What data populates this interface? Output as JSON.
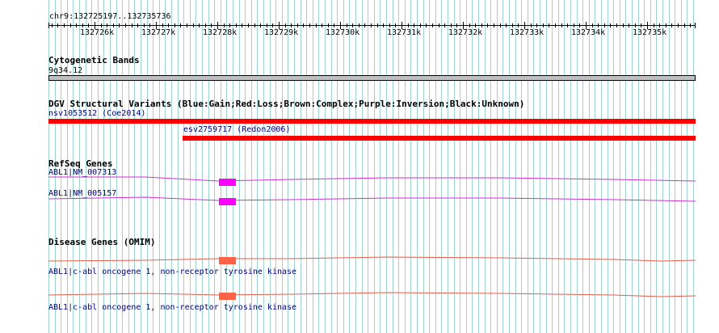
{
  "ruler": {
    "position": "chr9:132725197..132735736",
    "ticks": [
      "132726k",
      "132727k",
      "132728k",
      "132729k",
      "132730k",
      "132731k",
      "132732k",
      "132733k",
      "132734k",
      "132735k"
    ]
  },
  "tracks": {
    "cytoband": {
      "title": "Cytogenetic Bands",
      "band_label": "9q34.12"
    },
    "dgv": {
      "title": "DGV Structural Variants (Blue:Gain;Red:Loss;Brown:Complex;Purple:Inversion;Black:Unknown)",
      "features": [
        {
          "label": "nsv1053512 (Coe2014)",
          "color": "#ff0000"
        },
        {
          "label": "esv2759717 (Redon2006)",
          "color": "#ff0000"
        }
      ]
    },
    "refseq": {
      "title": "RefSeq Genes",
      "features": [
        {
          "label": "ABL1|NM_007313",
          "color": "#cc00cc",
          "exon_color": "#ff00ff"
        },
        {
          "label": "ABL1|NM_005157",
          "color": "#cc00cc",
          "exon_color": "#ff00ff"
        }
      ]
    },
    "omim": {
      "title": "Disease Genes (OMIM)",
      "features": [
        {
          "label": "ABL1|c-abl oncogene 1, non-receptor tyrosine kinase",
          "color": "#e06050",
          "exon_color": "#ff6347"
        },
        {
          "label": "ABL1|c-abl oncogene 1, non-receptor tyrosine kinase",
          "color": "#e06050",
          "exon_color": "#ff6347"
        }
      ]
    }
  },
  "colors": {
    "grid": "#9fd3d3",
    "cytoband_fill": "#c0c0c0"
  }
}
